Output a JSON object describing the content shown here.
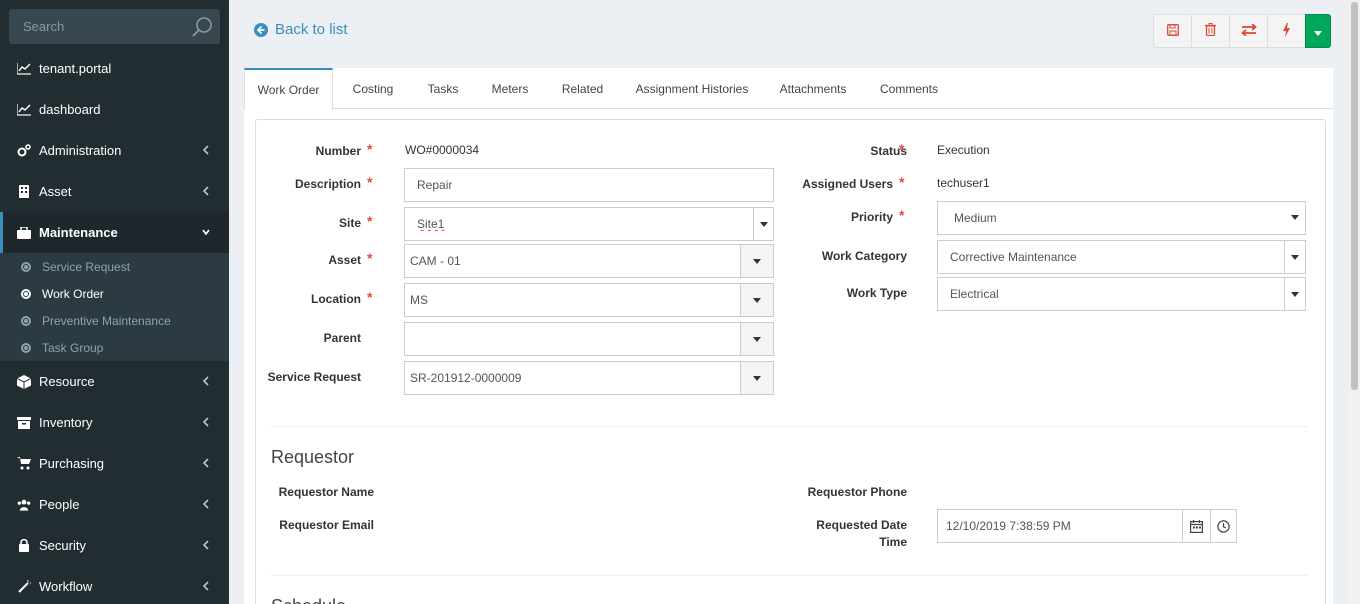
{
  "sidebar": {
    "search_placeholder": "Search",
    "items": [
      {
        "label": "tenant.portal",
        "icon": "line-chart-icon"
      },
      {
        "label": "dashboard",
        "icon": "line-chart-icon"
      },
      {
        "label": "Administration",
        "icon": "cogs-icon"
      },
      {
        "label": "Asset",
        "icon": "building-icon"
      },
      {
        "label": "Maintenance",
        "icon": "briefcase-icon"
      },
      {
        "label": "Resource",
        "icon": "cube-icon"
      },
      {
        "label": "Inventory",
        "icon": "archive-icon"
      },
      {
        "label": "Purchasing",
        "icon": "cart-icon"
      },
      {
        "label": "People",
        "icon": "users-icon"
      },
      {
        "label": "Security",
        "icon": "lock-icon"
      },
      {
        "label": "Workflow",
        "icon": "wand-icon"
      }
    ],
    "submenu": [
      {
        "label": "Service Request"
      },
      {
        "label": "Work Order"
      },
      {
        "label": "Preventive Maintenance"
      },
      {
        "label": "Task Group"
      }
    ]
  },
  "header": {
    "back_label": "Back to list"
  },
  "toolbar": {
    "buttons": [
      "save-icon",
      "trash-icon",
      "exchange-icon",
      "bolt-icon",
      "caret-down-icon"
    ],
    "accent": "#00a65a",
    "danger": "#dd4b39"
  },
  "tabs": [
    {
      "label": "Work Order"
    },
    {
      "label": "Costing"
    },
    {
      "label": "Tasks"
    },
    {
      "label": "Meters"
    },
    {
      "label": "Related"
    },
    {
      "label": "Assignment Histories"
    },
    {
      "label": "Attachments"
    },
    {
      "label": "Comments"
    }
  ],
  "form": {
    "number_label": "Number",
    "number_value": "WO#0000034",
    "description_label": "Description",
    "description_value": "Repair",
    "site_label": "Site",
    "site_value": "Site1",
    "asset_label": "Asset",
    "asset_value": "CAM - 01",
    "location_label": "Location",
    "location_value": "MS",
    "parent_label": "Parent",
    "parent_value": "",
    "service_request_label": "Service Request",
    "service_request_value": "SR-201912-0000009",
    "status_label": "Status",
    "status_value": "Execution",
    "assigned_users_label": "Assigned Users",
    "assigned_users_value": "techuser1",
    "priority_label": "Priority",
    "priority_value": "Medium",
    "work_category_label": "Work Category",
    "work_category_value": "Corrective Maintenance",
    "work_type_label": "Work Type",
    "work_type_value": "Electrical",
    "required_mark": "*"
  },
  "requestor": {
    "title": "Requestor",
    "name_label": "Requestor Name",
    "email_label": "Requestor Email",
    "phone_label": "Requestor Phone",
    "requested_datetime_label_1": "Requested Date",
    "requested_datetime_label_2": "Time",
    "requested_datetime_value": "12/10/2019 7:38:59 PM"
  },
  "schedule": {
    "title": "Schedule"
  },
  "colors": {
    "sidebar_bg": "#222d32",
    "link": "#3c8dbc",
    "required": "#dd4b39"
  }
}
